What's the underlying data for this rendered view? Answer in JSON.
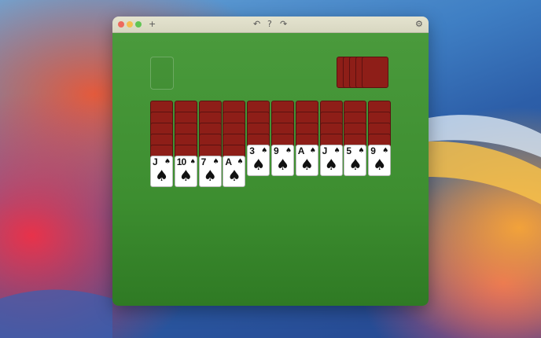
{
  "toolbar": {
    "new_game_icon": "plus-icon",
    "undo_icon": "undo-icon",
    "help_icon": "question-icon",
    "redo_icon": "redo-icon",
    "settings_icon": "gear-icon",
    "new_label": "+",
    "undo_label": "↶",
    "help_label": "?",
    "redo_label": "↷",
    "settings_label": "⚙"
  },
  "colors": {
    "felt": "#3d8e30",
    "card_back": "#8e1e18",
    "card_face": "#ffffff"
  },
  "stock": {
    "remaining_piles": 5
  },
  "tableau": [
    {
      "facedown_count": 5,
      "top_card": {
        "rank": "J",
        "suit": "♠"
      }
    },
    {
      "facedown_count": 5,
      "top_card": {
        "rank": "10",
        "suit": "♠"
      }
    },
    {
      "facedown_count": 5,
      "top_card": {
        "rank": "7",
        "suit": "♠"
      }
    },
    {
      "facedown_count": 5,
      "top_card": {
        "rank": "A",
        "suit": "♠"
      }
    },
    {
      "facedown_count": 4,
      "top_card": {
        "rank": "3",
        "suit": "♠"
      }
    },
    {
      "facedown_count": 4,
      "top_card": {
        "rank": "9",
        "suit": "♠"
      }
    },
    {
      "facedown_count": 4,
      "top_card": {
        "rank": "A",
        "suit": "♠"
      }
    },
    {
      "facedown_count": 4,
      "top_card": {
        "rank": "J",
        "suit": "♠"
      }
    },
    {
      "facedown_count": 4,
      "top_card": {
        "rank": "5",
        "suit": "♠"
      }
    },
    {
      "facedown_count": 4,
      "top_card": {
        "rank": "9",
        "suit": "♠"
      }
    }
  ]
}
